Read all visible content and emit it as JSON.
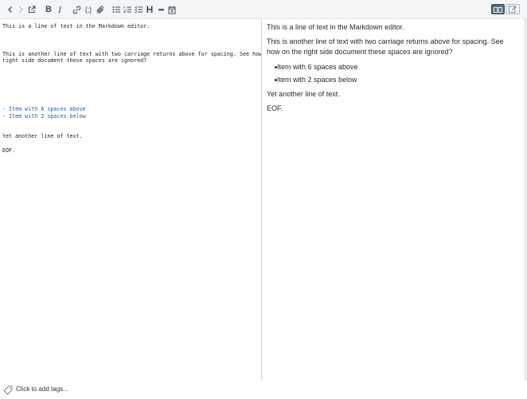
{
  "toolbar": {
    "icons": [
      "back-icon",
      "forward-icon",
      "external-link-icon",
      "bold-icon",
      "italic-icon",
      "link-icon",
      "code-icon",
      "attachment-icon",
      "bullet-list-icon",
      "numbered-list-icon",
      "checklist-icon",
      "heading-icon",
      "horizontal-rule-icon",
      "insert-time-icon"
    ],
    "bold_glyph": "B",
    "italic_glyph": "I",
    "code_glyph": "{;}",
    "heading_glyph": "H",
    "hr_glyph": "•••"
  },
  "editor": {
    "line1": "This is a line of text in the Markdown editor.",
    "line2a": "This is another line of text with two carriage returns above for spacing. See how on the",
    "line2b": "right side document these spaces are ignored?",
    "list1": "- Item with 6 spaces above",
    "list2": "- Item with 2 spaces below",
    "line3": "Yet another line of text.",
    "line4": "EOF."
  },
  "viewer": {
    "p1": "This is a line of text in the Markdown editor.",
    "p2": "This is another line of text with two carriage returns above for spacing. See how on the right side document these spaces are ignored?",
    "items": [
      "Item with 6 spaces above",
      "Item with 2 spaces below"
    ],
    "p3": "Yet another line of text.",
    "p4": "EOF."
  },
  "footer": {
    "tags_label": "Click to add tags..."
  },
  "colors": {
    "toolbar_bg": "#f4f5f6",
    "icon": "#3c4b5c",
    "list_text": "#1d5d9b",
    "toggle_active": "#5a6b80"
  }
}
